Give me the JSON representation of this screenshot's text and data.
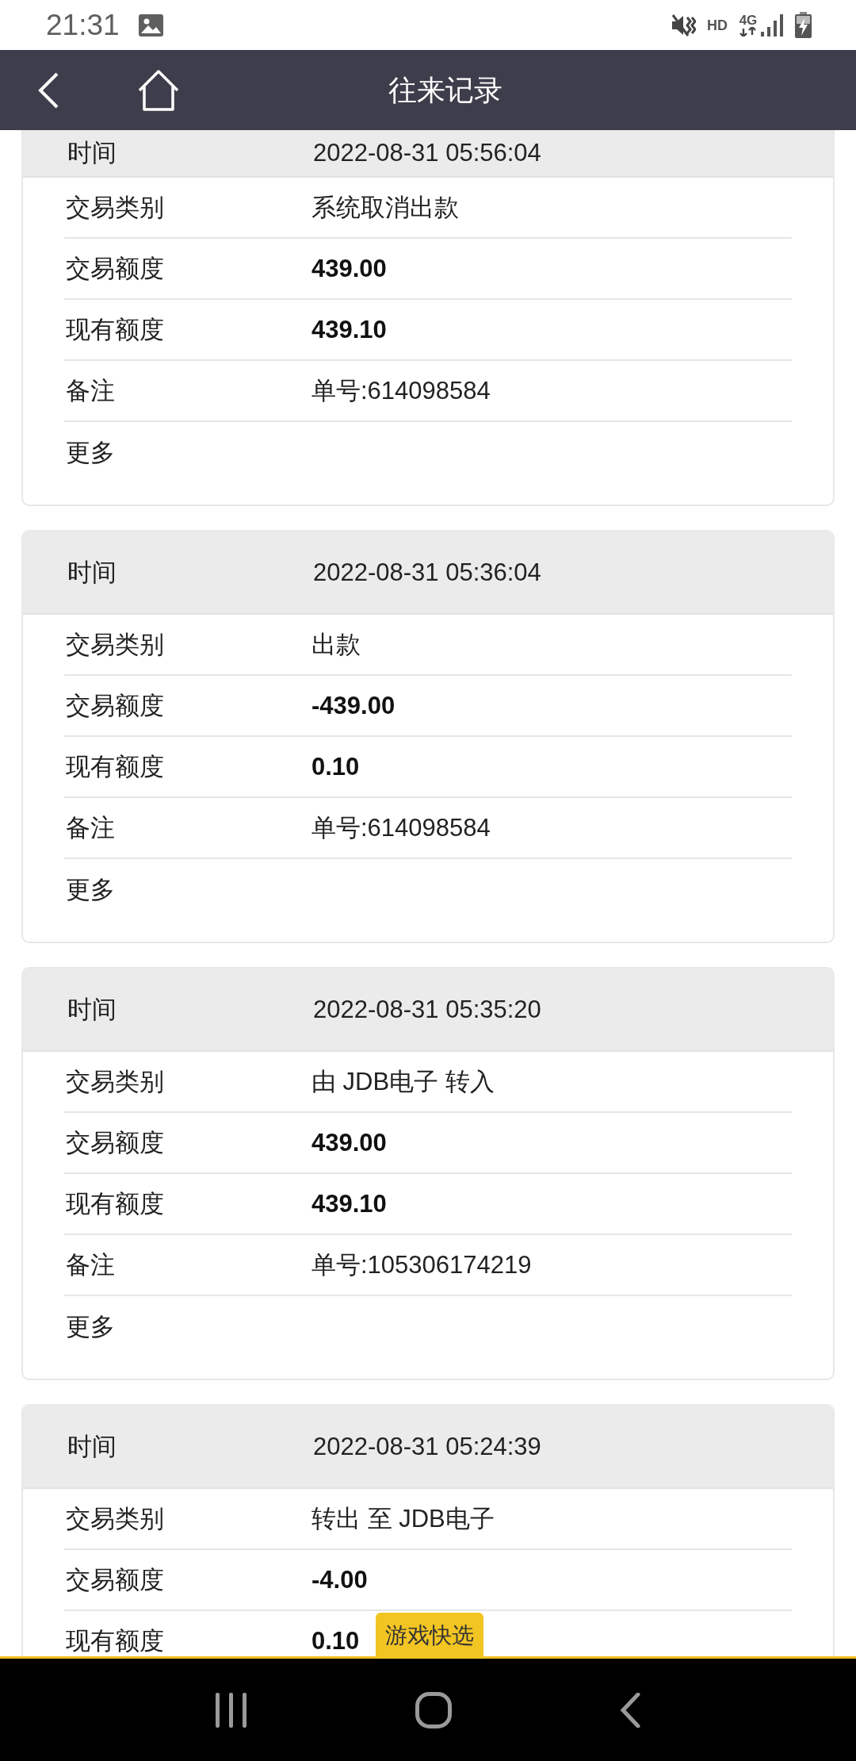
{
  "status_bar": {
    "time": "21:31",
    "network_labels": [
      "HD",
      "4G"
    ]
  },
  "header": {
    "title": "往来记录"
  },
  "records": [
    {
      "time_label": "时间",
      "time": "2022-08-31 05:56:04",
      "fields": [
        {
          "label": "交易类别",
          "value": "系统取消出款",
          "kind": "text"
        },
        {
          "label": "交易额度",
          "value": "439.00",
          "kind": "amount"
        },
        {
          "label": "现有额度",
          "value": "439.10",
          "kind": "amount"
        },
        {
          "label": "备注",
          "value": "单号:614098584",
          "kind": "text"
        }
      ],
      "more": "更多"
    },
    {
      "time_label": "时间",
      "time": "2022-08-31 05:36:04",
      "fields": [
        {
          "label": "交易类别",
          "value": "出款",
          "kind": "text"
        },
        {
          "label": "交易额度",
          "value": "-439.00",
          "kind": "amount"
        },
        {
          "label": "现有额度",
          "value": "0.10",
          "kind": "amount"
        },
        {
          "label": "备注",
          "value": "单号:614098584",
          "kind": "text"
        }
      ],
      "more": "更多"
    },
    {
      "time_label": "时间",
      "time": "2022-08-31 05:35:20",
      "fields": [
        {
          "label": "交易类别",
          "value": "由 JDB电子 转入",
          "kind": "text"
        },
        {
          "label": "交易额度",
          "value": "439.00",
          "kind": "amount"
        },
        {
          "label": "现有额度",
          "value": "439.10",
          "kind": "amount"
        },
        {
          "label": "备注",
          "value": "单号:105306174219",
          "kind": "text"
        }
      ],
      "more": "更多"
    },
    {
      "time_label": "时间",
      "time": "2022-08-31 05:24:39",
      "fields": [
        {
          "label": "交易类别",
          "value": "转出 至 JDB电子",
          "kind": "text"
        },
        {
          "label": "交易额度",
          "value": "-4.00",
          "kind": "amount"
        },
        {
          "label": "现有额度",
          "value": "0.10",
          "kind": "amount"
        }
      ]
    }
  ],
  "quick_tab": {
    "label": "游戏快选"
  }
}
